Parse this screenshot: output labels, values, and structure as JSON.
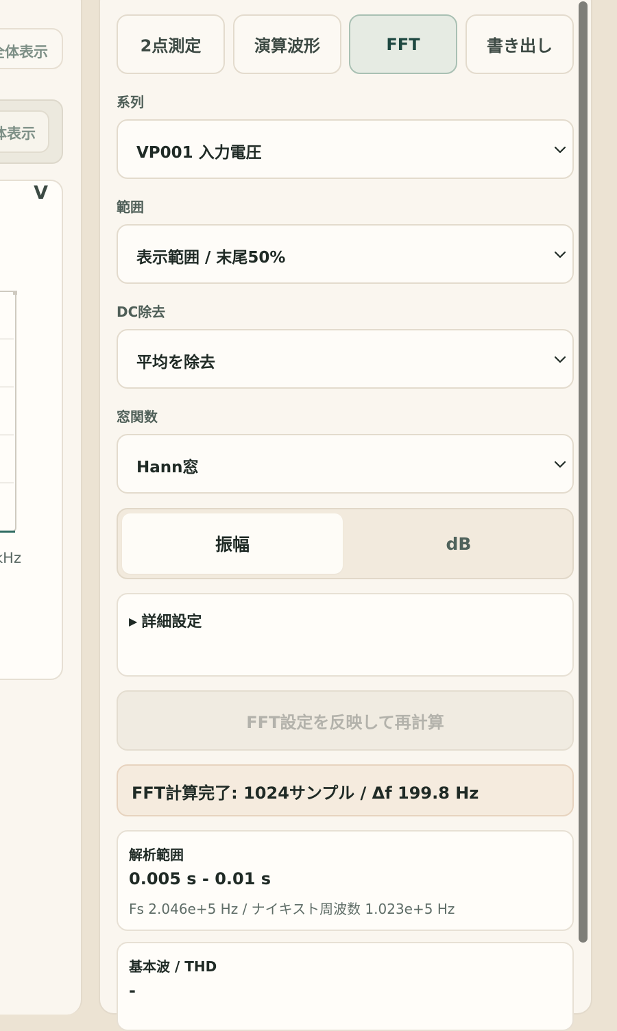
{
  "left_panel": {
    "fit_all_button_1": "全体表示",
    "fit_all_button_2": "体表示",
    "unit_label": "V",
    "axis_unit_label": "kHz"
  },
  "tabs": [
    {
      "label": "2点測定",
      "active": false
    },
    {
      "label": "演算波形",
      "active": false
    },
    {
      "label": "FFT",
      "active": true
    },
    {
      "label": "書き出し",
      "active": false
    }
  ],
  "fields": {
    "series": {
      "label": "系列",
      "value": "VP001 入力電圧"
    },
    "range": {
      "label": "範囲",
      "value": "表示範囲 / 末尾50%"
    },
    "dc_removal": {
      "label": "DC除去",
      "value": "平均を除去"
    },
    "window": {
      "label": "窓関数",
      "value": "Hann窓"
    }
  },
  "scale_toggle": {
    "amplitude": "振幅",
    "db": "dB",
    "selected": "振幅"
  },
  "details": {
    "summary": "詳細設定"
  },
  "recalc_button": "FFT設定を反映して再計算",
  "status_message": "FFT計算完了: 1024サンプル / Δf 199.8 Hz",
  "analysis_range": {
    "title": "解析範囲",
    "value": "0.005 s - 0.01 s",
    "detail": "Fs 2.046e+5 Hz / ナイキスト周波数 1.023e+5 Hz"
  },
  "fundamental": {
    "title": "基本波 / THD",
    "value": "-"
  },
  "colors": {
    "background": "#ece3d3",
    "panel": "#faf6ef",
    "accent": "#1d4740",
    "active_tab_bg": "#e6ebe3",
    "status_bg": "#f5ebde"
  }
}
